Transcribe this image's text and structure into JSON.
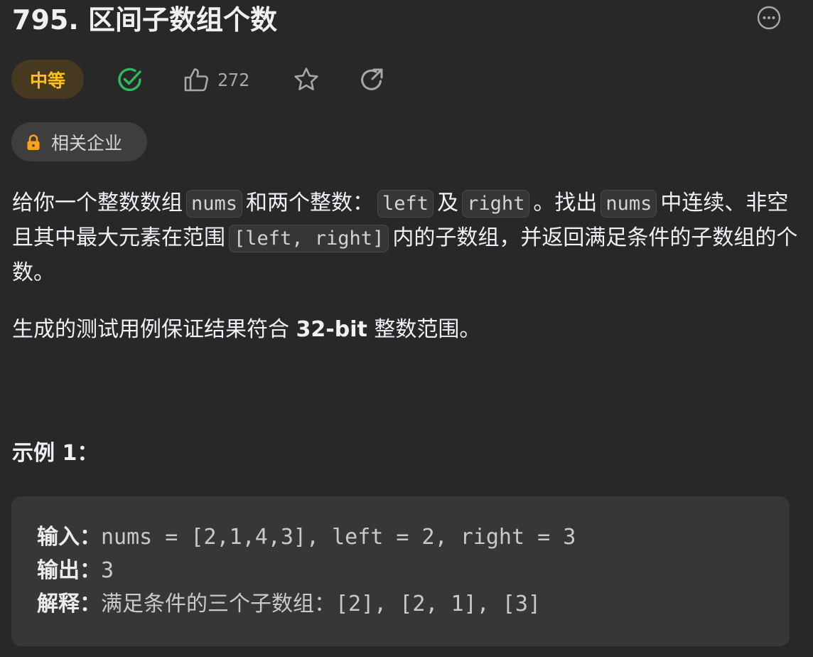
{
  "problem": {
    "title": "795. 区间子数组个数",
    "difficulty": "中等",
    "likes": "272",
    "companies_label": "相关企业"
  },
  "description": {
    "p1": {
      "t1": "给你一个整数数组",
      "c1": "nums",
      "t2": "和两个整数：",
      "c2": "left",
      "t3": "及",
      "c3": "right",
      "t4": "。找出",
      "c4": "nums",
      "t5": "中连续、非空且其中最大元素在范围",
      "c5": "[left, right]",
      "t6": "内的子数组，并返回满足条件的子数组的个数。"
    },
    "p2": {
      "t1": "生成的测试用例保证结果符合",
      "b1": "32-bit",
      "t2": "整数范围。"
    }
  },
  "example1": {
    "title": "示例 1：",
    "input_label": "输入：",
    "input_value": "nums = [2,1,4,3], left = 2, right = 3",
    "output_label": "输出：",
    "output_value": "3",
    "explanation_label": "解释：",
    "explanation_value": "满足条件的三个子数组：[2], [2, 1], [3]"
  },
  "colors": {
    "background": "#282828",
    "difficulty_medium": "#ffc01e",
    "solved_check": "#2cbb5d",
    "lock": "#ffa116"
  },
  "icons": [
    "more-options-icon",
    "solved-check-icon",
    "thumbs-up-icon",
    "star-icon",
    "share-icon",
    "lock-icon"
  ]
}
